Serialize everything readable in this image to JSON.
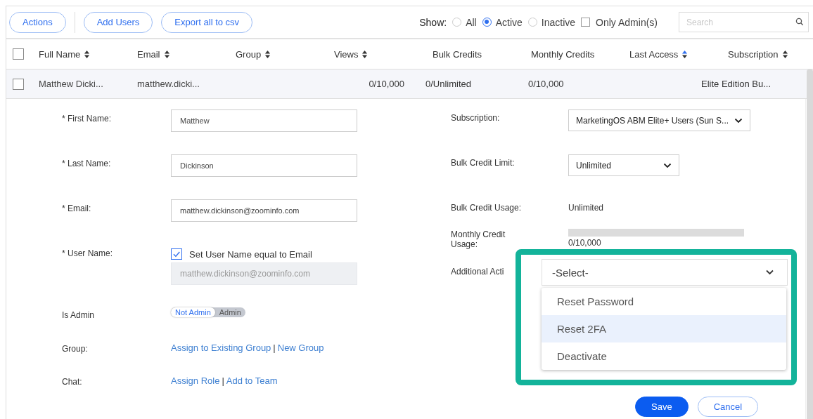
{
  "toolbar": {
    "button_groups": [
      [
        "Actions"
      ],
      [
        "Add Users",
        "Export all to csv"
      ]
    ],
    "show_label": "Show:",
    "filters": [
      {
        "label": "All",
        "selected": false
      },
      {
        "label": "Active",
        "selected": true
      },
      {
        "label": "Inactive",
        "selected": false
      }
    ],
    "only_admin": {
      "label": "Only Admin(s)",
      "checked": false
    },
    "search": {
      "placeholder": "Search"
    }
  },
  "table": {
    "select_all": {
      "checked": false
    },
    "columns": [
      {
        "label": "Full Name",
        "sortable": true,
        "sorted": false
      },
      {
        "label": "Email",
        "sortable": true,
        "sorted": false
      },
      {
        "label": "Group",
        "sortable": true,
        "sorted": false
      },
      {
        "label": "Views",
        "sortable": true,
        "sorted": false
      },
      {
        "label": "Bulk Credits",
        "sortable": false
      },
      {
        "label": "Monthly Credits",
        "sortable": false
      },
      {
        "label": "Last Access",
        "sortable": true,
        "sorted": true
      },
      {
        "label": "Subscription",
        "sortable": true,
        "sorted": false
      }
    ],
    "rows": [
      {
        "checked": false,
        "cells": [
          "Matthew Dicki...",
          "matthew.dicki...",
          "",
          "0/10,000",
          "0/Unlimited",
          "0/10,000",
          "",
          "Elite Edition Bu..."
        ]
      }
    ]
  },
  "form": {
    "left": [
      {
        "kind": "input",
        "label": "* First Name:",
        "value": "Matthew"
      },
      {
        "kind": "input",
        "label": "* Last Name:",
        "value": "Dickinson"
      },
      {
        "kind": "input",
        "label": "* Email:",
        "value": "matthew.dickinson@zoominfo.com"
      },
      {
        "kind": "checkbox_input",
        "label": "* User Name:",
        "checkbox_label": "Set User Name equal to Email",
        "checked": true,
        "value": "matthew.dickinson@zoominfo.com"
      },
      {
        "kind": "toggle",
        "label": "Is Admin",
        "options": [
          {
            "label": "Not Admin",
            "selected": true
          },
          {
            "label": "Admin",
            "selected": false
          }
        ]
      },
      {
        "kind": "links",
        "label": "Group:",
        "links": [
          "Assign to Existing Group",
          "New Group"
        ],
        "separator": "|"
      },
      {
        "kind": "links",
        "label": "Chat:",
        "links": [
          "Assign Role",
          "Add to Team"
        ],
        "separator": "|"
      }
    ],
    "right": [
      {
        "kind": "select",
        "label": "Subscription:",
        "value": "MarketingOS ABM Elite+ Users (Sun S..."
      },
      {
        "kind": "select",
        "label": "Bulk Credit Limit:",
        "value": "Unlimited"
      },
      {
        "kind": "text",
        "label": "Bulk Credit Usage:",
        "value": "Unlimited"
      },
      {
        "kind": "meter",
        "label": "Monthly Credit Usage:",
        "level": 0,
        "reading": "0/10,000"
      },
      {
        "kind": "label",
        "label": "Additional Acti"
      }
    ],
    "dropdown": {
      "value": "-Select-",
      "options": [
        {
          "label": "Reset Password",
          "selected": false
        },
        {
          "label": "Reset 2FA",
          "selected": true
        },
        {
          "label": "Deactivate",
          "selected": false
        }
      ]
    },
    "actions": [
      {
        "label": "Save",
        "primary": true
      },
      {
        "label": "Cancel",
        "primary": false
      }
    ]
  }
}
